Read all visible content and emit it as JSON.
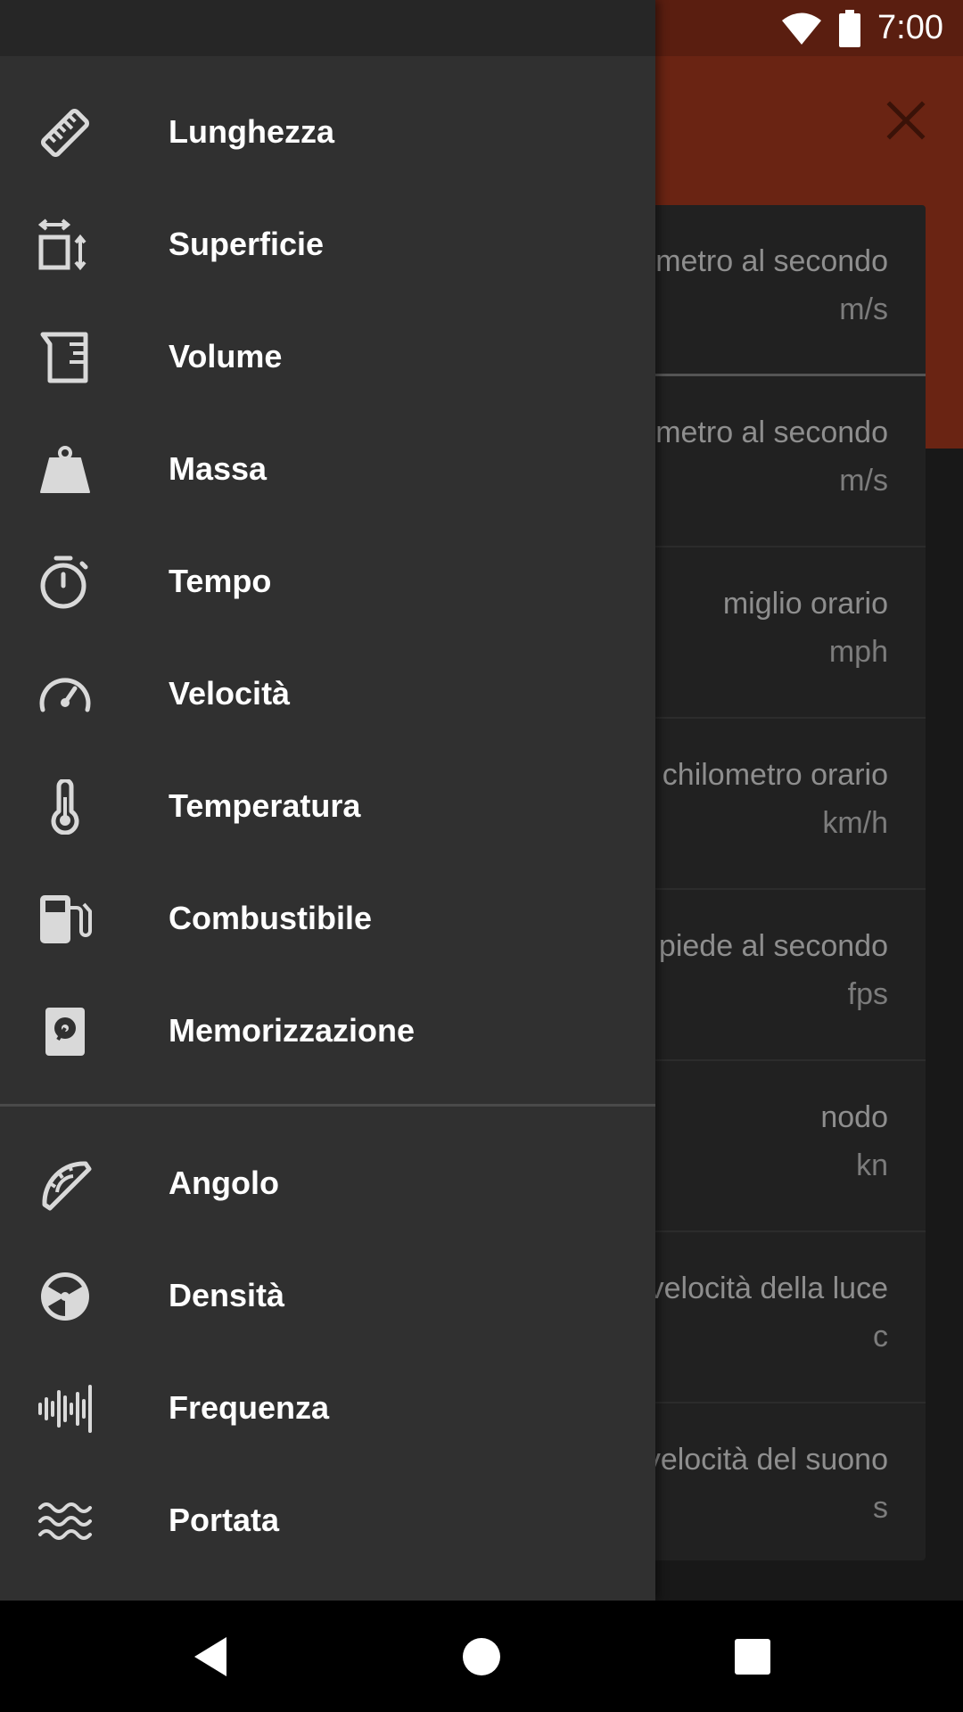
{
  "status_bar": {
    "time": "7:00",
    "icons": [
      "wifi-icon",
      "battery-icon"
    ]
  },
  "app": {
    "close_icon": "close-icon",
    "accent_color": "#6a2413",
    "units": [
      {
        "name": "metro al secondo",
        "abbr": "m/s"
      },
      {
        "name": "metro al secondo",
        "abbr": "m/s"
      },
      {
        "name": "miglio orario",
        "abbr": "mph"
      },
      {
        "name": "chilometro orario",
        "abbr": "km/h"
      },
      {
        "name": "piede al secondo",
        "abbr": "fps"
      },
      {
        "name": "nodo",
        "abbr": "kn"
      },
      {
        "name": "velocità della luce",
        "abbr": "c"
      },
      {
        "name": "velocità del suono",
        "abbr": "s"
      }
    ]
  },
  "drawer": {
    "items": [
      {
        "label": "Lunghezza",
        "icon": "ruler-icon"
      },
      {
        "label": "Superficie",
        "icon": "area-icon"
      },
      {
        "label": "Volume",
        "icon": "beaker-icon"
      },
      {
        "label": "Massa",
        "icon": "weight-icon"
      },
      {
        "label": "Tempo",
        "icon": "stopwatch-icon"
      },
      {
        "label": "Velocità",
        "icon": "speedometer-icon"
      },
      {
        "label": "Temperatura",
        "icon": "thermometer-icon"
      },
      {
        "label": "Combustibile",
        "icon": "fuel-icon"
      },
      {
        "label": "Memorizzazione",
        "icon": "storage-icon"
      }
    ],
    "secondary_items": [
      {
        "label": "Angolo",
        "icon": "protractor-icon"
      },
      {
        "label": "Densità",
        "icon": "density-icon"
      },
      {
        "label": "Frequenza",
        "icon": "waveform-icon"
      },
      {
        "label": "Portata",
        "icon": "waves-icon"
      }
    ]
  },
  "nav_bar": {
    "buttons": [
      "back-icon",
      "home-icon",
      "recents-icon"
    ]
  }
}
